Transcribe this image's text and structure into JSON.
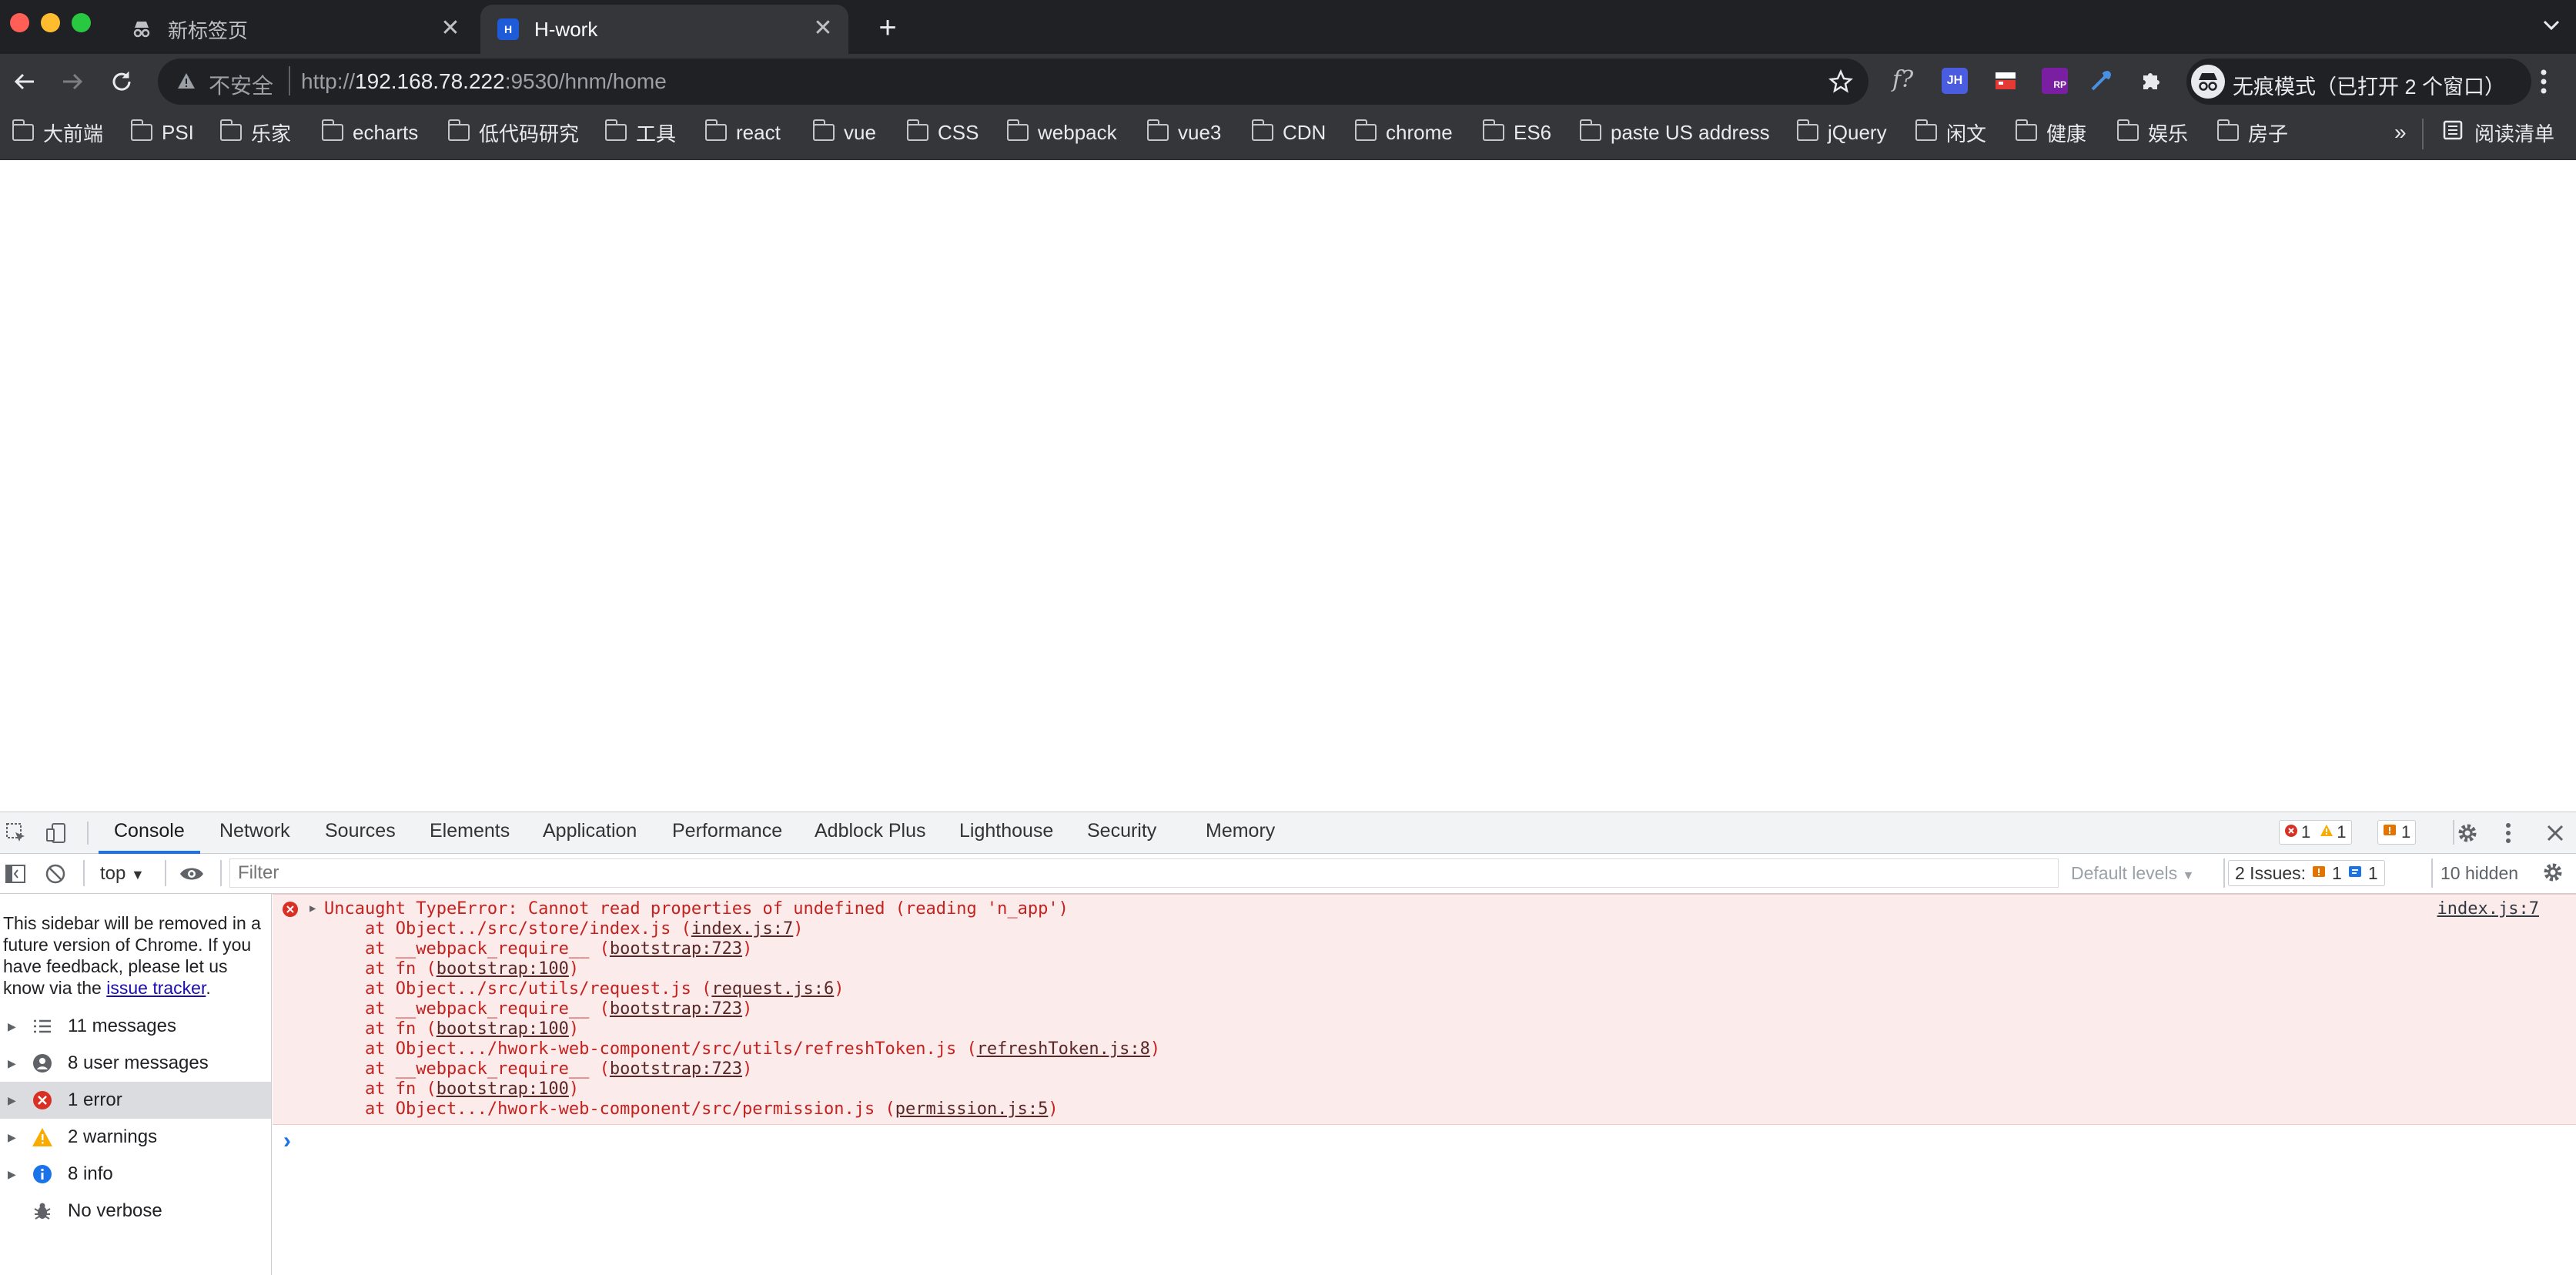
{
  "window": {
    "tabs": [
      {
        "title": "新标签页",
        "active": false
      },
      {
        "title": "H-work",
        "active": true
      }
    ]
  },
  "toolbar": {
    "security_label": "不安全",
    "url_scheme": "http://",
    "url_host": "192.168.78.222",
    "url_rest": ":9530/hnm/home",
    "profile_label": "无痕模式（已打开 2 个窗口）",
    "ext_jh": "JH",
    "ext_rp": "RP",
    "ext_f": "f?"
  },
  "bookmarks": {
    "items": [
      "大前端",
      "PSI",
      "乐家",
      "echarts",
      "低代码研究",
      "工具",
      "react",
      "vue",
      "CSS",
      "webpack",
      "vue3",
      "CDN",
      "chrome",
      "ES6",
      "paste US address",
      "jQuery",
      "闲文",
      "健康",
      "娱乐",
      "房子"
    ],
    "overflow": "»",
    "reading_list": "阅读清单"
  },
  "devtools": {
    "tabs": [
      "Console",
      "Network",
      "Sources",
      "Elements",
      "Application",
      "Performance",
      "Adblock Plus",
      "Lighthouse",
      "Security",
      "Memory"
    ],
    "active_tab": "Console",
    "badges": {
      "errors": "1",
      "warnings": "1",
      "issues": "1"
    },
    "console_bar": {
      "context": "top",
      "filter_placeholder": "Filter",
      "levels": "Default levels",
      "issues_label": "2 Issues:",
      "issues_warn": "1",
      "issues_info": "1",
      "hidden": "10 hidden"
    },
    "sidebar": {
      "note_text": "This sidebar will be removed in a future version of Chrome. If you have feedback, please let us know via the ",
      "note_link": "issue tracker",
      "note_end": ".",
      "items": [
        {
          "label": "11 messages",
          "icon": "list-icon"
        },
        {
          "label": "8 user messages",
          "icon": "user-icon"
        },
        {
          "label": "1 error",
          "icon": "error-icon"
        },
        {
          "label": "2 warnings",
          "icon": "warning-icon"
        },
        {
          "label": "8 info",
          "icon": "info-icon"
        },
        {
          "label": "No verbose",
          "icon": "bug-icon"
        }
      ]
    },
    "console": {
      "error_title": "Uncaught TypeError: Cannot read properties of undefined (reading 'n_app')",
      "error_source": "index.js:7",
      "stack": [
        {
          "pre": "    at Object../src/store/index.js (",
          "link": "index.js:7",
          "post": ")"
        },
        {
          "pre": "    at __webpack_require__ (",
          "link": "bootstrap:723",
          "post": ")"
        },
        {
          "pre": "    at fn (",
          "link": "bootstrap:100",
          "post": ")"
        },
        {
          "pre": "    at Object../src/utils/request.js (",
          "link": "request.js:6",
          "post": ")"
        },
        {
          "pre": "    at __webpack_require__ (",
          "link": "bootstrap:723",
          "post": ")"
        },
        {
          "pre": "    at fn (",
          "link": "bootstrap:100",
          "post": ")"
        },
        {
          "pre": "    at Object.../hwork-web-component/src/utils/refreshToken.js (",
          "link": "refreshToken.js:8",
          "post": ")"
        },
        {
          "pre": "    at __webpack_require__ (",
          "link": "bootstrap:723",
          "post": ")"
        },
        {
          "pre": "    at fn (",
          "link": "bootstrap:100",
          "post": ")"
        },
        {
          "pre": "    at Object.../hwork-web-component/src/permission.js (",
          "link": "permission.js:5",
          "post": ")"
        }
      ],
      "prompt": "›"
    }
  },
  "colors": {
    "chrome_dark": "#202124",
    "chrome_toolbar": "#35363a",
    "error_red": "#c5221f",
    "error_bg": "#fcebeb",
    "devtools_accent": "#1a73e8"
  }
}
